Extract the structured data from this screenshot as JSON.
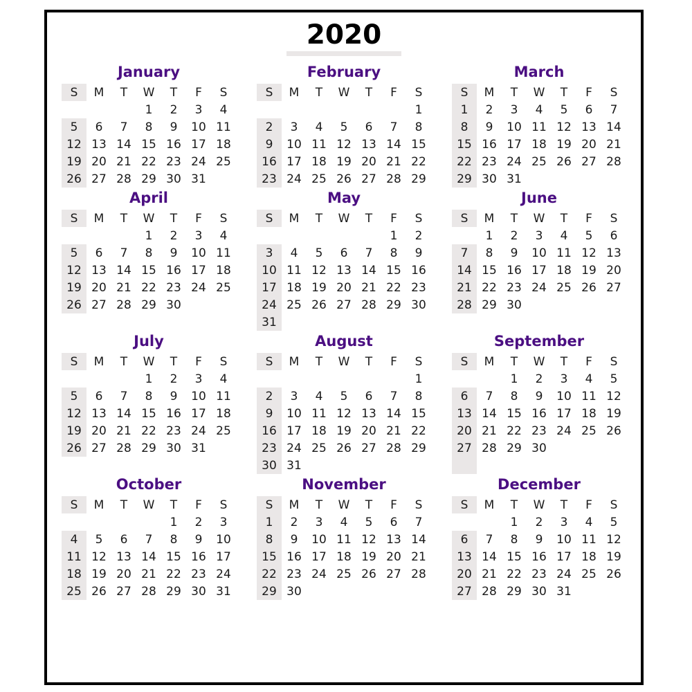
{
  "title": {
    "year": "2020"
  },
  "weekday_headers": [
    "S",
    "M",
    "T",
    "W",
    "T",
    "F",
    "S"
  ],
  "colors": {
    "month_name": "#4b0f82",
    "sunday_text": "#ff0000",
    "sunday_highlight": "#eae7e7",
    "day_text": "#1a1a1a",
    "title_text": "#000000",
    "border": "#000000",
    "background": "#ffffff"
  },
  "months": [
    {
      "name": "January",
      "first_weekday_index": 3,
      "days_in_month": 31,
      "weeks": [
        [
          "",
          "",
          "",
          "1",
          "2",
          "3",
          "4"
        ],
        [
          "5",
          "6",
          "7",
          "8",
          "9",
          "10",
          "11"
        ],
        [
          "12",
          "13",
          "14",
          "15",
          "16",
          "17",
          "18"
        ],
        [
          "19",
          "20",
          "21",
          "22",
          "23",
          "24",
          "25"
        ],
        [
          "26",
          "27",
          "28",
          "29",
          "30",
          "31",
          ""
        ]
      ]
    },
    {
      "name": "February",
      "first_weekday_index": 6,
      "days_in_month": 29,
      "weeks": [
        [
          "",
          "",
          "",
          "",
          "",
          "",
          "1"
        ],
        [
          "2",
          "3",
          "4",
          "5",
          "6",
          "7",
          "8"
        ],
        [
          "9",
          "10",
          "11",
          "12",
          "13",
          "14",
          "15"
        ],
        [
          "16",
          "17",
          "18",
          "19",
          "20",
          "21",
          "22"
        ],
        [
          "23",
          "24",
          "25",
          "26",
          "27",
          "28",
          "29"
        ]
      ]
    },
    {
      "name": "March",
      "first_weekday_index": 0,
      "days_in_month": 31,
      "weeks": [
        [
          "1",
          "2",
          "3",
          "4",
          "5",
          "6",
          "7"
        ],
        [
          "8",
          "9",
          "10",
          "11",
          "12",
          "13",
          "14"
        ],
        [
          "15",
          "16",
          "17",
          "18",
          "19",
          "20",
          "21"
        ],
        [
          "22",
          "23",
          "24",
          "25",
          "26",
          "27",
          "28"
        ],
        [
          "29",
          "30",
          "31",
          "",
          "",
          "",
          ""
        ]
      ]
    },
    {
      "name": "April",
      "first_weekday_index": 3,
      "days_in_month": 30,
      "weeks": [
        [
          "",
          "",
          "",
          "1",
          "2",
          "3",
          "4"
        ],
        [
          "5",
          "6",
          "7",
          "8",
          "9",
          "10",
          "11"
        ],
        [
          "12",
          "13",
          "14",
          "15",
          "16",
          "17",
          "18"
        ],
        [
          "19",
          "20",
          "21",
          "22",
          "23",
          "24",
          "25"
        ],
        [
          "26",
          "27",
          "28",
          "29",
          "30",
          "",
          ""
        ]
      ]
    },
    {
      "name": "May",
      "first_weekday_index": 5,
      "days_in_month": 31,
      "weeks": [
        [
          "",
          "",
          "",
          "",
          "",
          "1",
          "2"
        ],
        [
          "3",
          "4",
          "5",
          "6",
          "7",
          "8",
          "9"
        ],
        [
          "10",
          "11",
          "12",
          "13",
          "14",
          "15",
          "16"
        ],
        [
          "17",
          "18",
          "19",
          "20",
          "21",
          "22",
          "23"
        ],
        [
          "24",
          "25",
          "26",
          "27",
          "28",
          "29",
          "30"
        ],
        [
          "31",
          "",
          "",
          "",
          "",
          "",
          ""
        ]
      ]
    },
    {
      "name": "June",
      "first_weekday_index": 1,
      "days_in_month": 30,
      "weeks": [
        [
          "",
          "1",
          "2",
          "3",
          "4",
          "5",
          "6"
        ],
        [
          "7",
          "8",
          "9",
          "10",
          "11",
          "12",
          "13"
        ],
        [
          "14",
          "15",
          "16",
          "17",
          "18",
          "19",
          "20"
        ],
        [
          "21",
          "22",
          "23",
          "24",
          "25",
          "26",
          "27"
        ],
        [
          "28",
          "29",
          "30",
          "",
          "",
          "",
          ""
        ]
      ]
    },
    {
      "name": "July",
      "first_weekday_index": 3,
      "days_in_month": 31,
      "weeks": [
        [
          "",
          "",
          "",
          "1",
          "2",
          "3",
          "4"
        ],
        [
          "5",
          "6",
          "7",
          "8",
          "9",
          "10",
          "11"
        ],
        [
          "12",
          "13",
          "14",
          "15",
          "16",
          "17",
          "18"
        ],
        [
          "19",
          "20",
          "21",
          "22",
          "23",
          "24",
          "25"
        ],
        [
          "26",
          "27",
          "28",
          "29",
          "30",
          "31",
          ""
        ]
      ]
    },
    {
      "name": "August",
      "first_weekday_index": 6,
      "days_in_month": 31,
      "weeks": [
        [
          "",
          "",
          "",
          "",
          "",
          "",
          "1"
        ],
        [
          "2",
          "3",
          "4",
          "5",
          "6",
          "7",
          "8"
        ],
        [
          "9",
          "10",
          "11",
          "12",
          "13",
          "14",
          "15"
        ],
        [
          "16",
          "17",
          "18",
          "19",
          "20",
          "21",
          "22"
        ],
        [
          "23",
          "24",
          "25",
          "26",
          "27",
          "28",
          "29"
        ],
        [
          "30",
          "31",
          "",
          "",
          "",
          "",
          ""
        ]
      ]
    },
    {
      "name": "September",
      "first_weekday_index": 2,
      "days_in_month": 30,
      "weeks": [
        [
          "",
          "",
          "1",
          "2",
          "3",
          "4",
          "5"
        ],
        [
          "6",
          "7",
          "8",
          "9",
          "10",
          "11",
          "12"
        ],
        [
          "13",
          "14",
          "15",
          "16",
          "17",
          "18",
          "19"
        ],
        [
          "20",
          "21",
          "22",
          "23",
          "24",
          "25",
          "26"
        ],
        [
          "27",
          "28",
          "29",
          "30",
          "",
          "",
          ""
        ],
        [
          "",
          "",
          "",
          "",
          "",
          "",
          ""
        ]
      ]
    },
    {
      "name": "October",
      "first_weekday_index": 4,
      "days_in_month": 31,
      "weeks": [
        [
          "",
          "",
          "",
          "",
          "1",
          "2",
          "3"
        ],
        [
          "4",
          "5",
          "6",
          "7",
          "8",
          "9",
          "10"
        ],
        [
          "11",
          "12",
          "13",
          "14",
          "15",
          "16",
          "17"
        ],
        [
          "18",
          "19",
          "20",
          "21",
          "22",
          "23",
          "24"
        ],
        [
          "25",
          "26",
          "27",
          "28",
          "29",
          "30",
          "31"
        ]
      ]
    },
    {
      "name": "November",
      "first_weekday_index": 0,
      "days_in_month": 30,
      "weeks": [
        [
          "1",
          "2",
          "3",
          "4",
          "5",
          "6",
          "7"
        ],
        [
          "8",
          "9",
          "10",
          "11",
          "12",
          "13",
          "14"
        ],
        [
          "15",
          "16",
          "17",
          "18",
          "19",
          "20",
          "21"
        ],
        [
          "22",
          "23",
          "24",
          "25",
          "26",
          "27",
          "28"
        ],
        [
          "29",
          "30",
          "",
          "",
          "",
          "",
          ""
        ]
      ]
    },
    {
      "name": "December",
      "first_weekday_index": 2,
      "days_in_month": 31,
      "weeks": [
        [
          "",
          "",
          "1",
          "2",
          "3",
          "4",
          "5"
        ],
        [
          "6",
          "7",
          "8",
          "9",
          "10",
          "11",
          "12"
        ],
        [
          "13",
          "14",
          "15",
          "16",
          "17",
          "18",
          "19"
        ],
        [
          "20",
          "21",
          "22",
          "23",
          "24",
          "25",
          "26"
        ],
        [
          "27",
          "28",
          "29",
          "30",
          "31",
          "",
          ""
        ]
      ]
    }
  ]
}
